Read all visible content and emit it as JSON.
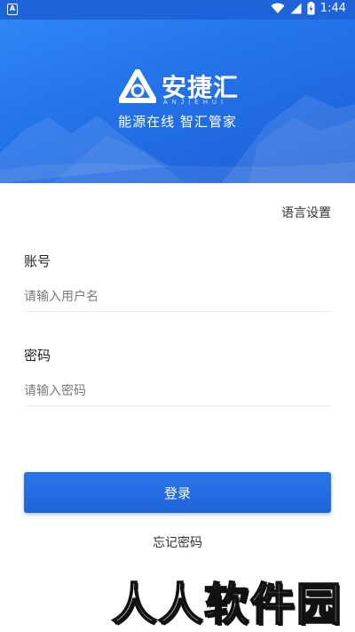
{
  "status_bar": {
    "time": "1:44",
    "app_icon_letter": "A",
    "icons": [
      "wifi-icon",
      "signal-icon",
      "battery-icon"
    ]
  },
  "hero": {
    "brand_name": "安捷汇",
    "brand_sub": "ANJIEHUI",
    "slogan": "能源在线  智汇管家",
    "colors": {
      "gradient_start": "#2f86f5",
      "gradient_end": "#1d5fd6"
    }
  },
  "form": {
    "language_link": "语言设置",
    "account_label": "账号",
    "account_placeholder": "请输入用户名",
    "account_value": "",
    "password_label": "密码",
    "password_placeholder": "请输入密码",
    "password_value": "",
    "login_button": "登录",
    "forgot_link": "忘记密码"
  },
  "watermark": {
    "text": "人人软件园"
  },
  "colors": {
    "accent": "#1f63d8",
    "divider": "#ececec"
  }
}
